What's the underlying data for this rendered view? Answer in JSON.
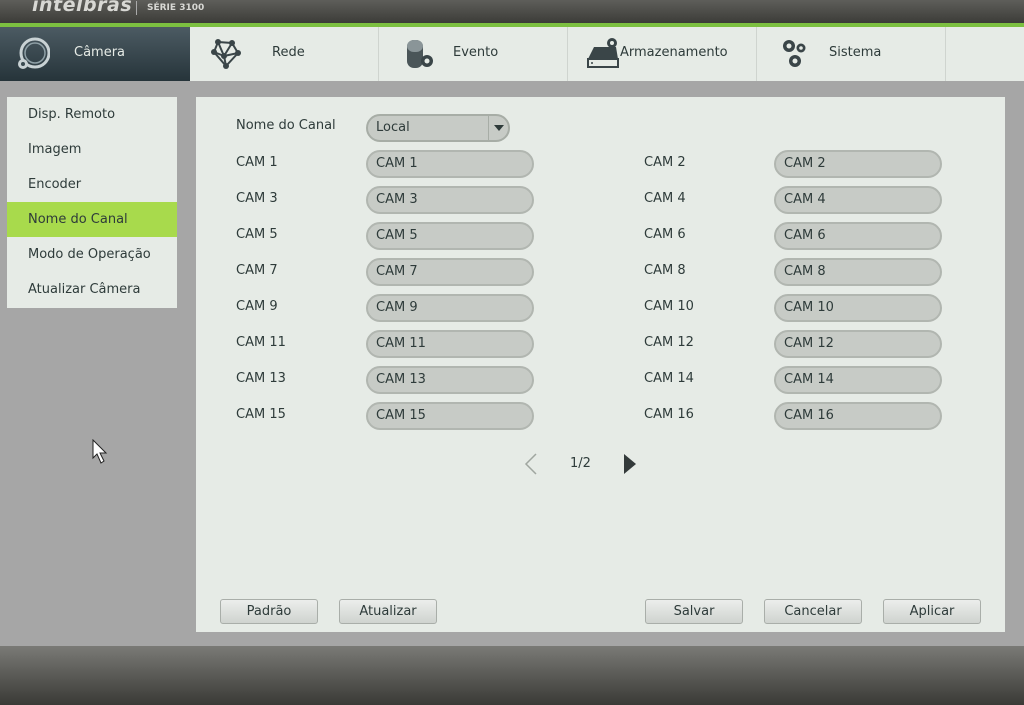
{
  "header": {
    "brand": "intelbras",
    "series": "SÉRIE 3100"
  },
  "nav": {
    "tabs": [
      {
        "label": "Câmera",
        "icon": "camera-gear-icon",
        "active": true
      },
      {
        "label": "Rede",
        "icon": "network-icon",
        "active": false
      },
      {
        "label": "Evento",
        "icon": "alarm-light-icon",
        "active": false
      },
      {
        "label": "Armazenamento",
        "icon": "hard-drive-icon",
        "active": false
      },
      {
        "label": "Sistema",
        "icon": "gears-icon",
        "active": false
      }
    ]
  },
  "sidebar": {
    "items": [
      {
        "label": "Disp. Remoto",
        "active": false
      },
      {
        "label": "Imagem",
        "active": false
      },
      {
        "label": "Encoder",
        "active": false
      },
      {
        "label": "Nome do Canal",
        "active": true
      },
      {
        "label": "Modo de Operação",
        "active": false
      },
      {
        "label": "Atualizar Câmera",
        "active": false
      }
    ]
  },
  "main": {
    "channel_name_label": "Nome do Canal",
    "channel_select_value": "Local",
    "channels": [
      {
        "label": "CAM 1",
        "value": "CAM 1"
      },
      {
        "label": "CAM 2",
        "value": "CAM 2"
      },
      {
        "label": "CAM 3",
        "value": "CAM 3"
      },
      {
        "label": "CAM 4",
        "value": "CAM 4"
      },
      {
        "label": "CAM 5",
        "value": "CAM 5"
      },
      {
        "label": "CAM 6",
        "value": "CAM 6"
      },
      {
        "label": "CAM 7",
        "value": "CAM 7"
      },
      {
        "label": "CAM 8",
        "value": "CAM 8"
      },
      {
        "label": "CAM 9",
        "value": "CAM 9"
      },
      {
        "label": "CAM 10",
        "value": "CAM 10"
      },
      {
        "label": "CAM 11",
        "value": "CAM 11"
      },
      {
        "label": "CAM 12",
        "value": "CAM 12"
      },
      {
        "label": "CAM 13",
        "value": "CAM 13"
      },
      {
        "label": "CAM 14",
        "value": "CAM 14"
      },
      {
        "label": "CAM 15",
        "value": "CAM 15"
      },
      {
        "label": "CAM 16",
        "value": "CAM 16"
      }
    ],
    "pager": "1/2",
    "buttons": {
      "default": "Padrão",
      "refresh": "Atualizar",
      "save": "Salvar",
      "cancel": "Cancelar",
      "apply": "Aplicar"
    }
  },
  "colors": {
    "accent_green": "#a8da4c",
    "top_line_green": "#7cc040",
    "active_tab": "#2f3e45"
  }
}
